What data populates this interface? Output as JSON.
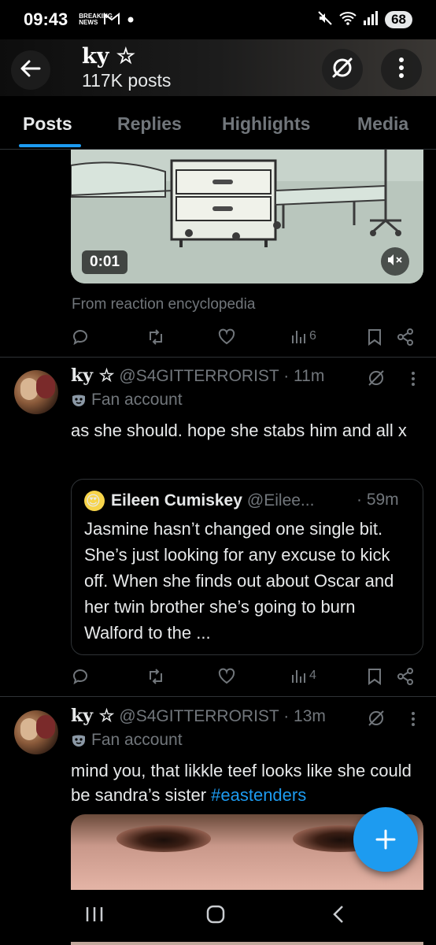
{
  "status_bar": {
    "time": "09:43",
    "notification_icons": [
      "breaking-news-icon",
      "gmail-icon",
      "dot-icon"
    ],
    "breaking_news_label": "BREAKING NEWS",
    "system_icons": [
      "mute-icon",
      "wifi-icon",
      "signal-icon"
    ],
    "battery": "68"
  },
  "header": {
    "title": "ky ☆",
    "subtitle": "117K posts"
  },
  "tabs": [
    {
      "label": "Posts",
      "active": true
    },
    {
      "label": "Replies",
      "active": false
    },
    {
      "label": "Highlights",
      "active": false
    },
    {
      "label": "Media",
      "active": false
    }
  ],
  "previous_post": {
    "video_time": "0:01",
    "from_text": "From reaction encyclopedia",
    "views": "6"
  },
  "tweet1": {
    "name": "ky ☆",
    "handle_time": "@S4GITTERRORIST · 11m",
    "label": "Fan account",
    "text": "as she should. hope she stabs him and all x",
    "quote": {
      "avatar_emoji": "😍",
      "name": "Eileen Cumiskey",
      "handle": "@Eilee...",
      "time": "· 59m",
      "text": "Jasmine hasn’t changed one single bit. She’s just looking for any excuse to kick off. When she finds out about Oscar and her twin brother she’s going to burn Walford to the ..."
    },
    "views": "4"
  },
  "tweet2": {
    "name": "ky ☆",
    "handle_time": "@S4GITTERRORIST · 13m",
    "label": "Fan account",
    "text_prefix": "mind you, that likkle teef looks like she could be sandra’s sister ",
    "hashtag": "#eastenders"
  },
  "colors": {
    "accent": "#1d9bf0",
    "muted": "#71767b",
    "text": "#e7e9ea",
    "background": "#000000",
    "divider": "#2f3336"
  }
}
